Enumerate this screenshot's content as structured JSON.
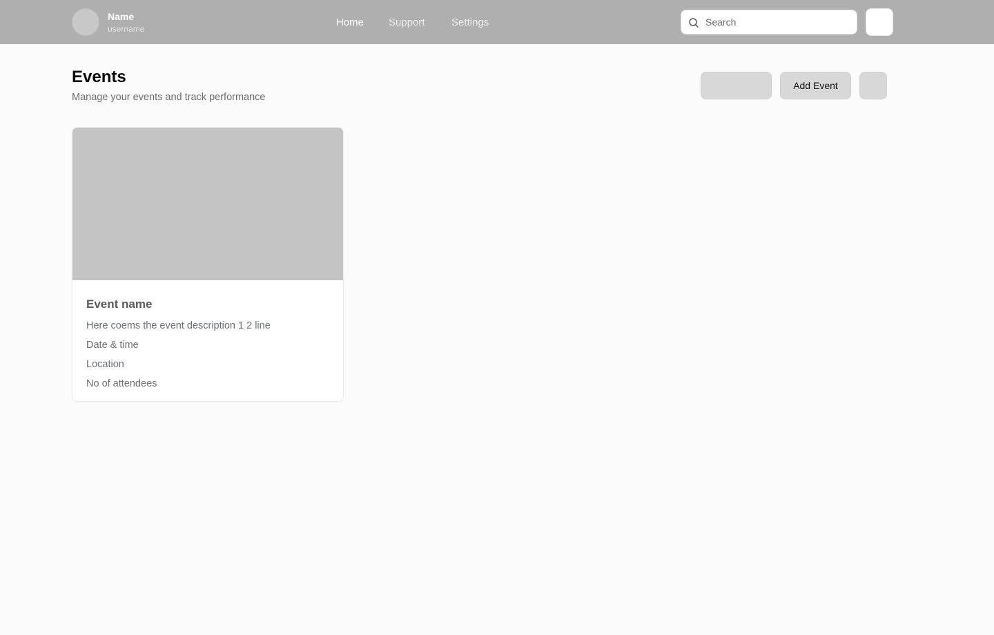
{
  "header": {
    "user": {
      "name": "Name",
      "username": "username"
    },
    "nav": [
      {
        "label": "Home",
        "active": true
      },
      {
        "label": "Support",
        "active": false
      },
      {
        "label": "Settings",
        "active": false
      }
    ],
    "search": {
      "placeholder": "Search",
      "value": "",
      "icon": "search-icon"
    }
  },
  "page": {
    "title": "Events",
    "subtitle": "Manage your events and track performance",
    "actions": {
      "add_event_label": "Add Event"
    }
  },
  "events": [
    {
      "name": "Event name",
      "description": "Here coems the event description 1 2 line",
      "datetime": "Date & time",
      "location": "Location",
      "attendees": "No of attendees"
    }
  ],
  "colors": {
    "topbar": "#afafaf",
    "background": "#fbfbfb",
    "button": "#d8d8d8",
    "image_placeholder": "#c4c4c4"
  }
}
